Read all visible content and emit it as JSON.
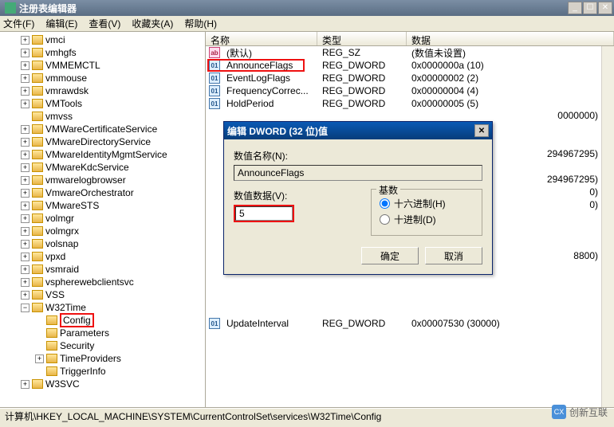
{
  "window": {
    "title": "注册表编辑器",
    "min": "_",
    "max": "☐",
    "close": "✕"
  },
  "menu": {
    "file": "文件(F)",
    "edit": "编辑(E)",
    "view": "查看(V)",
    "favorites": "收藏夹(A)",
    "help": "帮助(H)"
  },
  "listHeader": {
    "name": "名称",
    "type": "类型",
    "data": "数据"
  },
  "tree": [
    {
      "depth": 1,
      "exp": "+",
      "label": "vmci"
    },
    {
      "depth": 1,
      "exp": "+",
      "label": "vmhgfs"
    },
    {
      "depth": 1,
      "exp": "+",
      "label": "VMMEMCTL"
    },
    {
      "depth": 1,
      "exp": "+",
      "label": "vmmouse"
    },
    {
      "depth": 1,
      "exp": "+",
      "label": "vmrawdsk"
    },
    {
      "depth": 1,
      "exp": "+",
      "label": "VMTools"
    },
    {
      "depth": 1,
      "exp": "",
      "label": "vmvss"
    },
    {
      "depth": 1,
      "exp": "+",
      "label": "VMWareCertificateService"
    },
    {
      "depth": 1,
      "exp": "+",
      "label": "VMwareDirectoryService"
    },
    {
      "depth": 1,
      "exp": "+",
      "label": "VMwareIdentityMgmtService"
    },
    {
      "depth": 1,
      "exp": "+",
      "label": "VMwareKdcService"
    },
    {
      "depth": 1,
      "exp": "+",
      "label": "vmwarelogbrowser"
    },
    {
      "depth": 1,
      "exp": "+",
      "label": "VmwareOrchestrator"
    },
    {
      "depth": 1,
      "exp": "+",
      "label": "VMwareSTS"
    },
    {
      "depth": 1,
      "exp": "+",
      "label": "volmgr"
    },
    {
      "depth": 1,
      "exp": "+",
      "label": "volmgrx"
    },
    {
      "depth": 1,
      "exp": "+",
      "label": "volsnap"
    },
    {
      "depth": 1,
      "exp": "+",
      "label": "vpxd"
    },
    {
      "depth": 1,
      "exp": "+",
      "label": "vsmraid"
    },
    {
      "depth": 1,
      "exp": "+",
      "label": "vspherewebclientsvc"
    },
    {
      "depth": 1,
      "exp": "+",
      "label": "VSS"
    },
    {
      "depth": 1,
      "exp": "−",
      "label": "W32Time"
    },
    {
      "depth": 2,
      "exp": "",
      "label": "Config",
      "highlight": true
    },
    {
      "depth": 2,
      "exp": "",
      "label": "Parameters"
    },
    {
      "depth": 2,
      "exp": "",
      "label": "Security"
    },
    {
      "depth": 2,
      "exp": "+",
      "label": "TimeProviders"
    },
    {
      "depth": 2,
      "exp": "",
      "label": "TriggerInfo"
    },
    {
      "depth": 1,
      "exp": "+",
      "label": "W3SVC"
    }
  ],
  "values": [
    {
      "icon": "sz",
      "name": "(默认)",
      "type": "REG_SZ",
      "data": "(数值未设置)"
    },
    {
      "icon": "bin",
      "name": "AnnounceFlags",
      "type": "REG_DWORD",
      "data": "0x0000000a (10)",
      "highlight": true
    },
    {
      "icon": "bin",
      "name": "EventLogFlags",
      "type": "REG_DWORD",
      "data": "0x00000002 (2)"
    },
    {
      "icon": "bin",
      "name": "FrequencyCorrec...",
      "type": "REG_DWORD",
      "data": "0x00000004 (4)"
    },
    {
      "icon": "bin",
      "name": "HoldPeriod",
      "type": "REG_DWORD",
      "data": "0x00000005 (5)"
    }
  ],
  "partialValues": [
    {
      "data": "0000000)"
    },
    {
      "data": ""
    },
    {
      "data": ""
    },
    {
      "data": "294967295)"
    },
    {
      "data": ""
    },
    {
      "data": "294967295)"
    },
    {
      "data": "0)"
    },
    {
      "data": "0)"
    },
    {
      "data": ""
    },
    {
      "data": ""
    },
    {
      "data": ""
    },
    {
      "data": "8800)"
    }
  ],
  "lastValue": {
    "icon": "bin",
    "name": "UpdateInterval",
    "type": "REG_DWORD",
    "data": "0x00007530 (30000)"
  },
  "dialog": {
    "title": "编辑 DWORD (32 位)值",
    "nameLabel": "数值名称(N):",
    "nameValue": "AnnounceFlags",
    "dataLabel": "数值数据(V):",
    "dataValue": "5",
    "radixLabel": "基数",
    "hexLabel": "十六进制(H)",
    "decLabel": "十进制(D)",
    "ok": "确定",
    "cancel": "取消",
    "close": "✕"
  },
  "statusbar": "计算机\\HKEY_LOCAL_MACHINE\\SYSTEM\\CurrentControlSet\\services\\W32Time\\Config",
  "watermark": "创新互联"
}
